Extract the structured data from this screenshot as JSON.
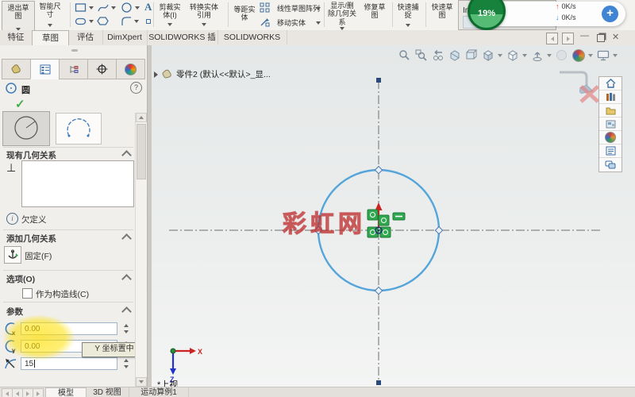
{
  "ribbon": {
    "exit_sketch": "退出草图",
    "smart_dimension": "智能尺寸",
    "trim": "剪裁实体(I)",
    "convert": "转换实体引用",
    "offset": "等距实体",
    "linear_pattern": "线性草图阵列",
    "move": "移动实体",
    "display_delete_relations": "显示/删除几何关系",
    "repair_sketch": "修复草图",
    "quick_snaps": "快速捕捉",
    "rapid_sketch": "快速草图",
    "instant": "Insta"
  },
  "overlay": {
    "percent": "19%",
    "up_speed": "0K/s",
    "down_speed": "0K/s",
    "plus": "+",
    "up_arrow": "↑",
    "down_arrow": "↓"
  },
  "tabs": {
    "items": [
      "特征",
      "草图",
      "评估",
      "DimXpert",
      "SOLIDWORKS 插件",
      "SOLIDWORKS MBD"
    ],
    "active": "草图"
  },
  "pm": {
    "title": "圆",
    "existing_relations_header": "现有几何关系",
    "status_label": "欠定义",
    "add_relations_header": "添加几何关系",
    "fix_label": "固定(F)",
    "options_header": "选项(O)",
    "construction_label": "作为构造线(C)",
    "parameters_header": "参数",
    "x_value": "0.00",
    "y_value": "0.00",
    "radius_value": "15",
    "tooltip": "Y 坐标置中"
  },
  "viewport": {
    "tree_label": "零件2 (默认<<默认>_显...",
    "view_label": "*上视",
    "watermark": "彩虹网",
    "axis_x": "X",
    "axis_z": "Z"
  },
  "bottom": {
    "tabs": [
      "模型",
      "3D 视图",
      "运动算例1"
    ],
    "active": "模型"
  },
  "icons": {
    "check": "✓",
    "help": "?",
    "perpendicular": "⊥",
    "info": "i",
    "text_tool": "A",
    "close": "✕",
    "minimize": "—",
    "cancel_x": "✕"
  },
  "colors": {
    "sketch_blue": "#55a5da",
    "relation_green": "#2fa84f",
    "watermark_red": "#cd3232",
    "progress_green": "#17823c"
  }
}
